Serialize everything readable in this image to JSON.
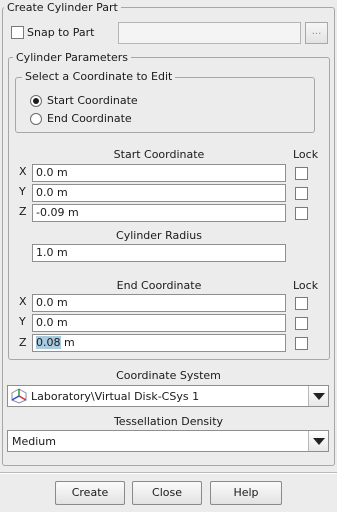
{
  "panel": {
    "title": "Create Cylinder Part"
  },
  "snap": {
    "label": "Snap to Part",
    "checked": false,
    "value": "",
    "browse_label": "..."
  },
  "cylinder_params": {
    "title": "Cylinder Parameters",
    "select_group": {
      "title": "Select a Coordinate to Edit",
      "options": [
        "Start Coordinate",
        "End Coordinate"
      ],
      "selected": "Start Coordinate"
    },
    "start": {
      "title": "Start Coordinate",
      "lock_label": "Lock",
      "axes": [
        {
          "axis": "X",
          "value": "0.0 m",
          "locked": false
        },
        {
          "axis": "Y",
          "value": "0.0 m",
          "locked": false
        },
        {
          "axis": "Z",
          "value": "-0.09 m",
          "locked": false
        }
      ]
    },
    "radius": {
      "title": "Cylinder Radius",
      "value": "1.0 m"
    },
    "end": {
      "title": "End Coordinate",
      "lock_label": "Lock",
      "axes": [
        {
          "axis": "X",
          "value": "0.0 m",
          "locked": false
        },
        {
          "axis": "Y",
          "value": "0.0 m",
          "locked": false
        },
        {
          "axis": "Z",
          "value": "0.08 m",
          "locked": false,
          "selected_text": "0.08"
        }
      ]
    }
  },
  "coordinate_system": {
    "title": "Coordinate System",
    "value": "Laboratory\\Virtual Disk-CSys 1",
    "icon": "coordinate-axes-icon"
  },
  "tessellation": {
    "title": "Tessellation Density",
    "value": "Medium"
  },
  "buttons": {
    "create": "Create",
    "close": "Close",
    "help": "Help"
  },
  "colors": {
    "background": "#ececec",
    "selection": "#a8cbe0",
    "border": "#a7a7a7"
  }
}
